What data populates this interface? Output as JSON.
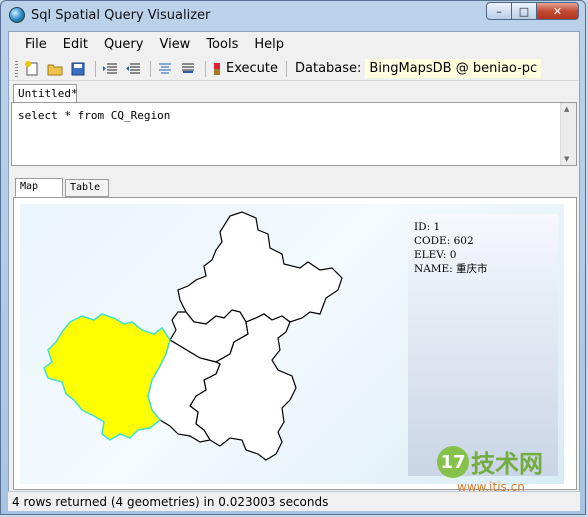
{
  "window": {
    "title": "Sql Spatial Query Visualizer",
    "controls": {
      "minimize": "–",
      "maximize": "□",
      "close": "✕"
    }
  },
  "menu": {
    "items": [
      {
        "label": "File"
      },
      {
        "label": "Edit"
      },
      {
        "label": "Query"
      },
      {
        "label": "View"
      },
      {
        "label": "Tools"
      },
      {
        "label": "Help"
      }
    ]
  },
  "toolbar": {
    "icons": [
      "new-file-icon",
      "open-folder-icon",
      "save-icon",
      "indent-icon",
      "outdent-icon",
      "align-icon",
      "comment-icon",
      "execute-flag-icon"
    ],
    "execute_label": "Execute",
    "database_label": "Database:",
    "database_value": "BingMapsDB @ beniao-pc"
  },
  "editor": {
    "tab_label": "Untitled*",
    "query_text": "select * from CQ_Region"
  },
  "results": {
    "tabs": [
      {
        "label": "Map"
      },
      {
        "label": "Table"
      }
    ],
    "highlight_color": "#ffff00",
    "highlight_border": "#40e0d0",
    "region_fill": "#ffffff",
    "info": {
      "id_line": "ID: 1",
      "code_line": "CODE: 602",
      "elev_line": "ELEV: 0",
      "name_line": "NAME: 重庆市"
    }
  },
  "watermark": {
    "logo": "17",
    "text": "技术网",
    "url": "www.itjs.cn"
  },
  "status": {
    "text": "4 rows returned (4 geometries) in 0.023003 seconds"
  }
}
